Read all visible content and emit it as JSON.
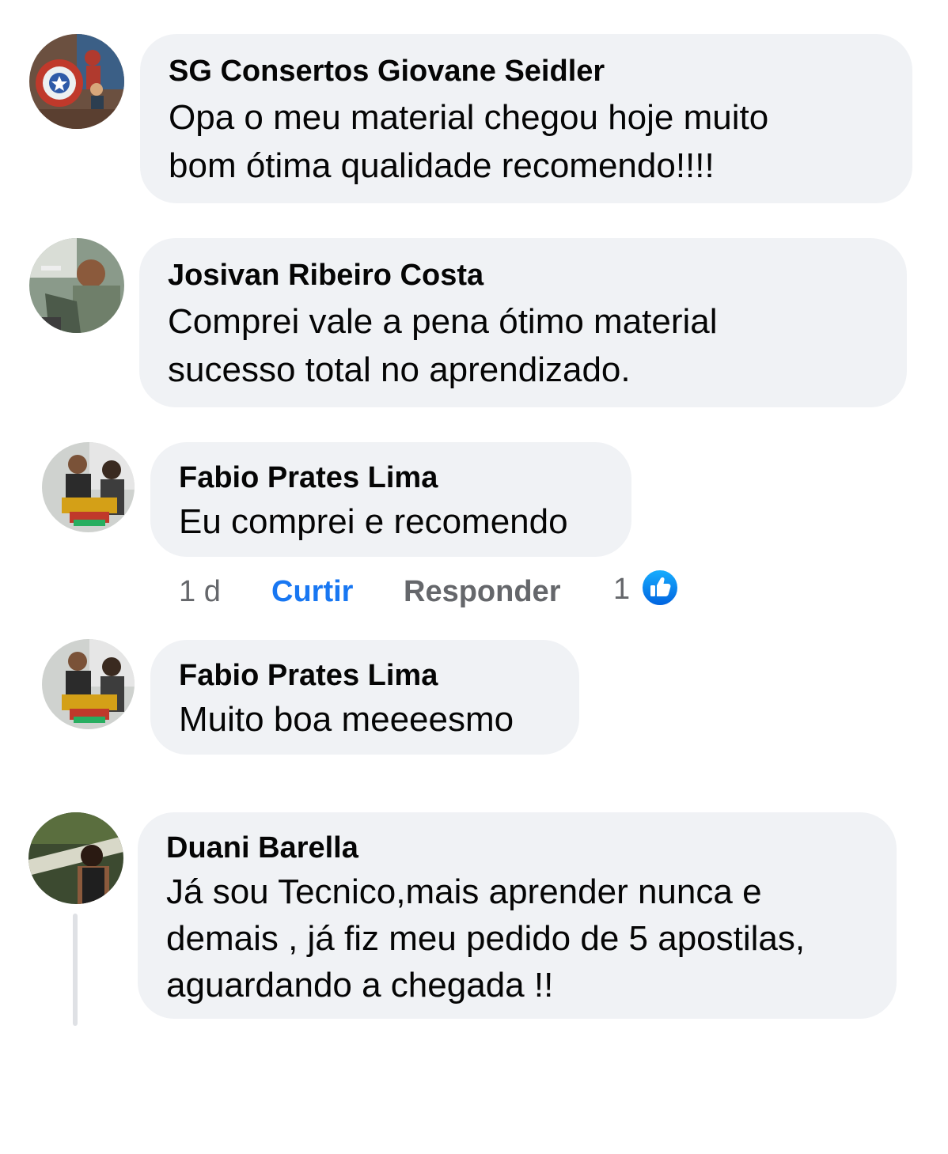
{
  "comments": [
    {
      "author": "SG Consertos Giovane Seidler",
      "lines": [
        "Opa o meu material chegou hoje muito",
        "bom ótima qualidade recomendo!!!!"
      ]
    },
    {
      "author": "Josivan Ribeiro Costa",
      "lines": [
        "Comprei vale a pena ótimo material",
        "sucesso total no aprendizado."
      ]
    },
    {
      "author": "Fabio Prates Lima",
      "lines": [
        "Eu comprei e recomendo"
      ],
      "actions": {
        "time": "1 d",
        "like": "Curtir",
        "reply": "Responder",
        "reaction_count": "1"
      }
    },
    {
      "author": "Fabio Prates Lima",
      "lines": [
        "Muito boa meeeesmo"
      ]
    },
    {
      "author": "Duani Barella",
      "lines": [
        "Já sou Tecnico,mais aprender nunca e",
        "demais , já fiz meu pedido de 5 apostilas,",
        "aguardando a chegada !!"
      ]
    }
  ],
  "colors": {
    "bubble": "#f0f2f5",
    "text": "#050505",
    "link": "#1877f2",
    "muted": "#65676b"
  },
  "icons": {
    "reaction": "like-thumb-icon"
  }
}
